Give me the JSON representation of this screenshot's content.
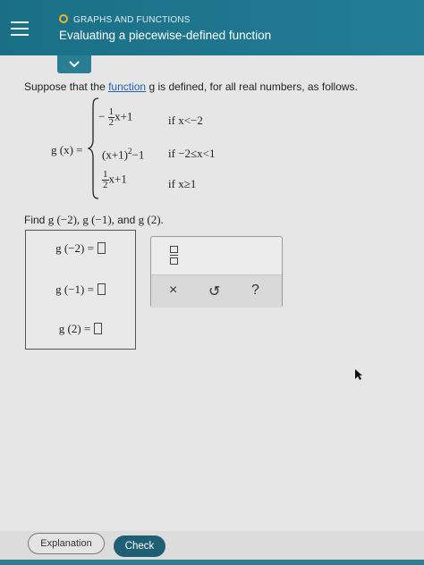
{
  "header": {
    "topic": "GRAPHS AND FUNCTIONS",
    "title": "Evaluating a piecewise-defined function"
  },
  "problem": {
    "intro_before": "Suppose that the ",
    "link_text": "function",
    "intro_after": " g is defined, for all real numbers, as follows.",
    "fn_label": "g (x) =",
    "pieces": [
      {
        "sign": "−",
        "num": "1",
        "den": "2",
        "expr": "x+1",
        "condition": "if x<−2"
      },
      {
        "expr": "(x+1)",
        "sup": "2",
        "tail": "−1",
        "condition": "if −2≤x<1"
      },
      {
        "num": "1",
        "den": "2",
        "expr": "x+1",
        "condition": "if x≥1"
      }
    ],
    "find_prefix": "Find ",
    "find_expr": "g (−2), g (−1),",
    "find_and": " and ",
    "find_last": "g (2).",
    "answers": [
      {
        "label": "g (−2) ="
      },
      {
        "label": "g (−1) ="
      },
      {
        "label": "g (2) ="
      }
    ]
  },
  "keypad": {
    "clear": "×",
    "undo": "↺",
    "help": "?"
  },
  "buttons": {
    "explanation": "Explanation",
    "check": "Check"
  },
  "colors": {
    "header": "#1a6f86",
    "accent_orange": "#f0b52a",
    "check_button": "#1f5f74",
    "link": "#1f63b8"
  }
}
